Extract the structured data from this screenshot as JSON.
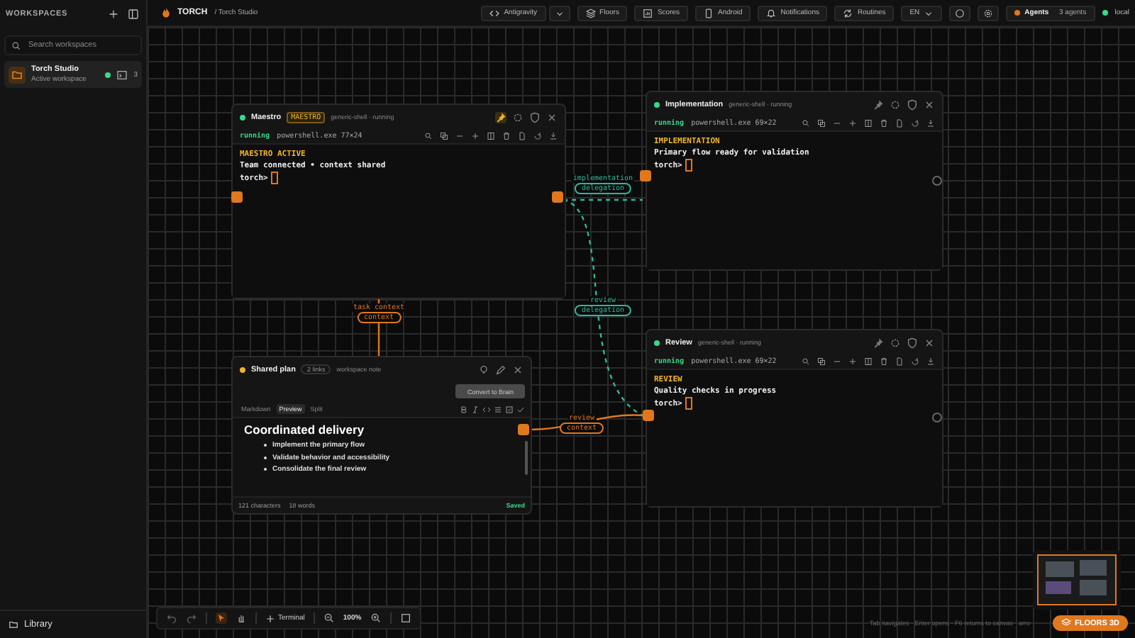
{
  "sidebar": {
    "title": "WORKSPACES",
    "search": {
      "placeholder": "Search workspaces"
    },
    "workspaces": [
      {
        "name": "Torch Studio",
        "subtitle": "Active workspace",
        "selected": true,
        "count": "3"
      }
    ],
    "footer": "Library"
  },
  "header": {
    "brand": "TORCH",
    "breadcrumb": "/ Torch Studio",
    "buttons": [
      {
        "kind": "code",
        "label": "Antigravity",
        "dropdown": true
      },
      {
        "kind": "floors",
        "label": "Floors"
      },
      {
        "kind": "scores",
        "label": "Scores"
      },
      {
        "kind": "android",
        "label": "Android"
      },
      {
        "kind": "bell",
        "label": "Notifications"
      },
      {
        "kind": "routine",
        "label": "Routines"
      }
    ],
    "language": "EN",
    "agents": {
      "label": "Agents",
      "count": "3 agents"
    },
    "host": "local"
  },
  "terminals": [
    {
      "title": "Maestro",
      "badge": "MAESTRO",
      "subtitle": "generic-shell · running",
      "status": "running",
      "process": "powershell.exe 77×24",
      "pinned": true,
      "heading": "MAESTRO ACTIVE",
      "lines": [
        "Team connected • context shared"
      ],
      "prompt": "torch>"
    },
    {
      "title": "Implementation",
      "subtitle": "generic-shell · running",
      "status": "running",
      "process": "powershell.exe 69×22",
      "pinned": false,
      "heading": "IMPLEMENTATION",
      "lines": [
        "Primary flow ready for validation"
      ],
      "prompt": "torch>"
    },
    {
      "title": "Review",
      "subtitle": "generic-shell · running",
      "status": "running",
      "process": "powershell.exe 69×22",
      "pinned": false,
      "heading": "REVIEW",
      "lines": [
        "Quality checks in progress"
      ],
      "prompt": "torch>"
    }
  ],
  "note": {
    "title": "Shared plan",
    "links": "2 links",
    "subtitle": "workspace note",
    "action": {
      "label": "Convert to Brain",
      "disabled": true
    },
    "tabs": [
      {
        "label": "Markdown",
        "selected": false
      },
      {
        "label": "Preview",
        "selected": true
      },
      {
        "label": "Split",
        "selected": false
      }
    ],
    "heading": "Coordinated delivery",
    "bullets": [
      "Implement the primary flow",
      "Validate behavior and accessibility",
      "Consolidate the final review"
    ],
    "characters": "121 characters",
    "words": "18 words",
    "status": "Saved"
  },
  "links": [
    {
      "kind": "delegation",
      "label": "implementation",
      "tag": "delegation"
    },
    {
      "kind": "delegation",
      "label": "review",
      "tag": "delegation"
    },
    {
      "kind": "context",
      "label": "task context",
      "tag": "context"
    },
    {
      "kind": "context",
      "label": "review",
      "tag": "context"
    }
  ],
  "toolbar": {
    "terminal": "Terminal",
    "zoom": "100%"
  },
  "hint": "Tab navigates · Enter opens · F6 returns to canvas · arro",
  "floors_button": "FLOORS 3D"
}
